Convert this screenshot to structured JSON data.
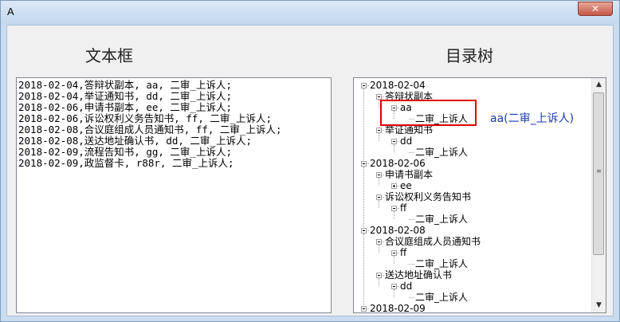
{
  "window": {
    "title": "A",
    "close_glyph": "✕"
  },
  "labels": {
    "textbox_label": "文本框",
    "tree_label": "目录树"
  },
  "textbox": {
    "lines": [
      "2018-02-04,答辩状副本, aa, 二审_上诉人;",
      "2018-02-04,举证通知书, dd, 二审_上诉人;",
      "2018-02-06,申请书副本, ee, 二审_上诉人;",
      "2018-02-06,诉讼权利义务告知书, ff, 二审_上诉人;",
      "2018-02-08,合议庭组成人员通知书, ff, 二审_上诉人;",
      "2018-02-08,送达地址确认书, dd, 二审_上诉人;",
      "2018-02-09,流程告知书, gg, 二审_上诉人;",
      "2018-02-09,政监督卡, r88r, 二审_上诉人;"
    ]
  },
  "tree": {
    "nodes": [
      {
        "text": "2018-02-04",
        "level": 0,
        "expander": "minus"
      },
      {
        "text": "答辩状副本",
        "level": 1,
        "expander": "minus"
      },
      {
        "text": "aa",
        "level": 2,
        "expander": "minus"
      },
      {
        "text": "二审_上诉人",
        "level": 3,
        "expander": "none"
      },
      {
        "text": "举证通知书",
        "level": 1,
        "expander": "minus"
      },
      {
        "text": "dd",
        "level": 2,
        "expander": "minus"
      },
      {
        "text": "二审_上诉人",
        "level": 3,
        "expander": "none"
      },
      {
        "text": "2018-02-06",
        "level": 0,
        "expander": "minus"
      },
      {
        "text": "申请书副本",
        "level": 1,
        "expander": "minus"
      },
      {
        "text": "ee",
        "level": 2,
        "expander": "plus"
      },
      {
        "text": "诉讼权利义务告知书",
        "level": 1,
        "expander": "minus"
      },
      {
        "text": "ff",
        "level": 2,
        "expander": "minus"
      },
      {
        "text": "二审_上诉人",
        "level": 3,
        "expander": "none"
      },
      {
        "text": "2018-02-08",
        "level": 0,
        "expander": "minus"
      },
      {
        "text": "合议庭组成人员通知书",
        "level": 1,
        "expander": "minus"
      },
      {
        "text": "ff",
        "level": 2,
        "expander": "minus"
      },
      {
        "text": "二审_上诉人",
        "level": 3,
        "expander": "none"
      },
      {
        "text": "送达地址确认书",
        "level": 1,
        "expander": "minus"
      },
      {
        "text": "dd",
        "level": 2,
        "expander": "minus"
      },
      {
        "text": "二审_上诉人",
        "level": 3,
        "expander": "none"
      },
      {
        "text": "2018-02-09",
        "level": 0,
        "expander": "minus"
      }
    ]
  },
  "annotation": {
    "text": "aa(二审_上诉人)",
    "color": "#1a3ab0",
    "highlight_color": "#e00000"
  }
}
